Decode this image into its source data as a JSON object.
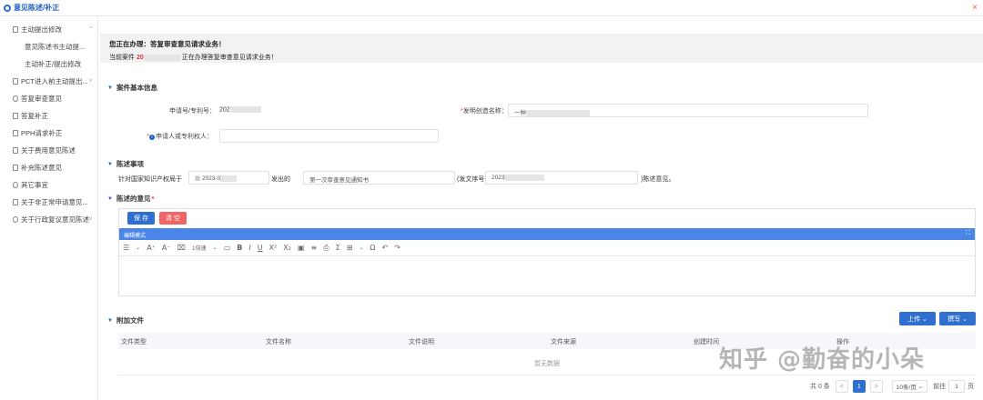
{
  "window": {
    "title": "意见陈述/补正",
    "close": "×"
  },
  "sidebar": {
    "items": [
      {
        "label": "主动提出修改",
        "chev": "^"
      },
      {
        "label": "意见陈述书主动提..."
      },
      {
        "label": "主动补正/提出修改"
      },
      {
        "label": "PCT进入前主动提出...",
        "chev": "v"
      },
      {
        "label": "答复审查意见"
      },
      {
        "label": "答复补正"
      },
      {
        "label": "PPH请求补正"
      },
      {
        "label": "关于费用意见陈述"
      },
      {
        "label": "补充陈述意见"
      },
      {
        "label": "其它事宜"
      },
      {
        "label": "关于非正常申请意见..."
      },
      {
        "label": "关于行政复议意见陈述",
        "chev": "v"
      }
    ]
  },
  "notice": {
    "line1": "您正在办理：答复审查意见请求业务！",
    "line2_prefix": "当前案件",
    "case_no": "20",
    "line2_suffix": "正在办理答复审查意见请求业务！"
  },
  "basic_info": {
    "section": "案件基本信息",
    "app_no_label": "申请号/专利号：",
    "app_no_value": "202",
    "invention_label": "发明创造名称：",
    "invention_value": "一种",
    "applicant_label": "申请人或专利权人：",
    "applicant_value": ""
  },
  "statement": {
    "section": "陈述事项",
    "prefix": "针对国家知识产权局于",
    "date_value": "2023-0",
    "issued": "发出的",
    "notice_type": "第一次审查意见通知书",
    "doc_no_label": "(发文序号",
    "doc_no_value": "2023",
    "suffix": ")陈述意见。"
  },
  "opinion": {
    "section": "陈述的意见",
    "save": "保 存",
    "clear": "清 空",
    "mode": "编辑模式",
    "expand": "⛶",
    "line_height": "1倍速"
  },
  "attachments": {
    "section": "附加文件",
    "upload": "上传",
    "write": "撰写",
    "columns": [
      "文件类型",
      "文件名称",
      "文件说明",
      "文件来源",
      "创建时间",
      "操作"
    ],
    "empty": "暂无数据"
  },
  "pagination": {
    "total": "共 0 条",
    "prev": "<",
    "current": "1",
    "next": ">",
    "size": "10条/页",
    "goto_label": "前往",
    "goto_value": "1",
    "page_unit": "页"
  },
  "watermark": "知乎 @勤奋的小朵",
  "colors": {
    "primary": "#2f6fd0",
    "danger": "#d9363e",
    "editor_bar": "#4a86e8"
  }
}
